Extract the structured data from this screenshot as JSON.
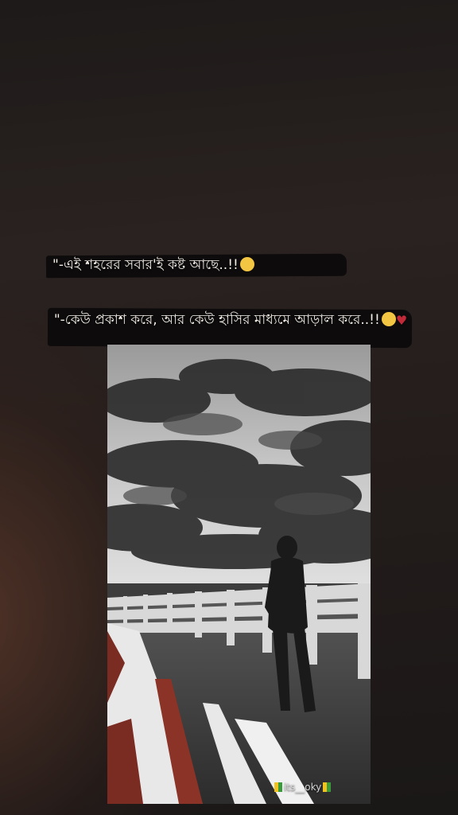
{
  "quote": {
    "line1": "\"-এই শহরের সবার'ই কষ্ট আছে..!!",
    "line2": "\"-কেউ প্রকাশ করে, আর কেউ হাসির মাধ্যমে আড়াল করে..!!"
  },
  "watermark": {
    "text": "its__oky"
  },
  "photo": {
    "subject": "silhouette of a man walking on a bridge under a cloudy sky"
  }
}
